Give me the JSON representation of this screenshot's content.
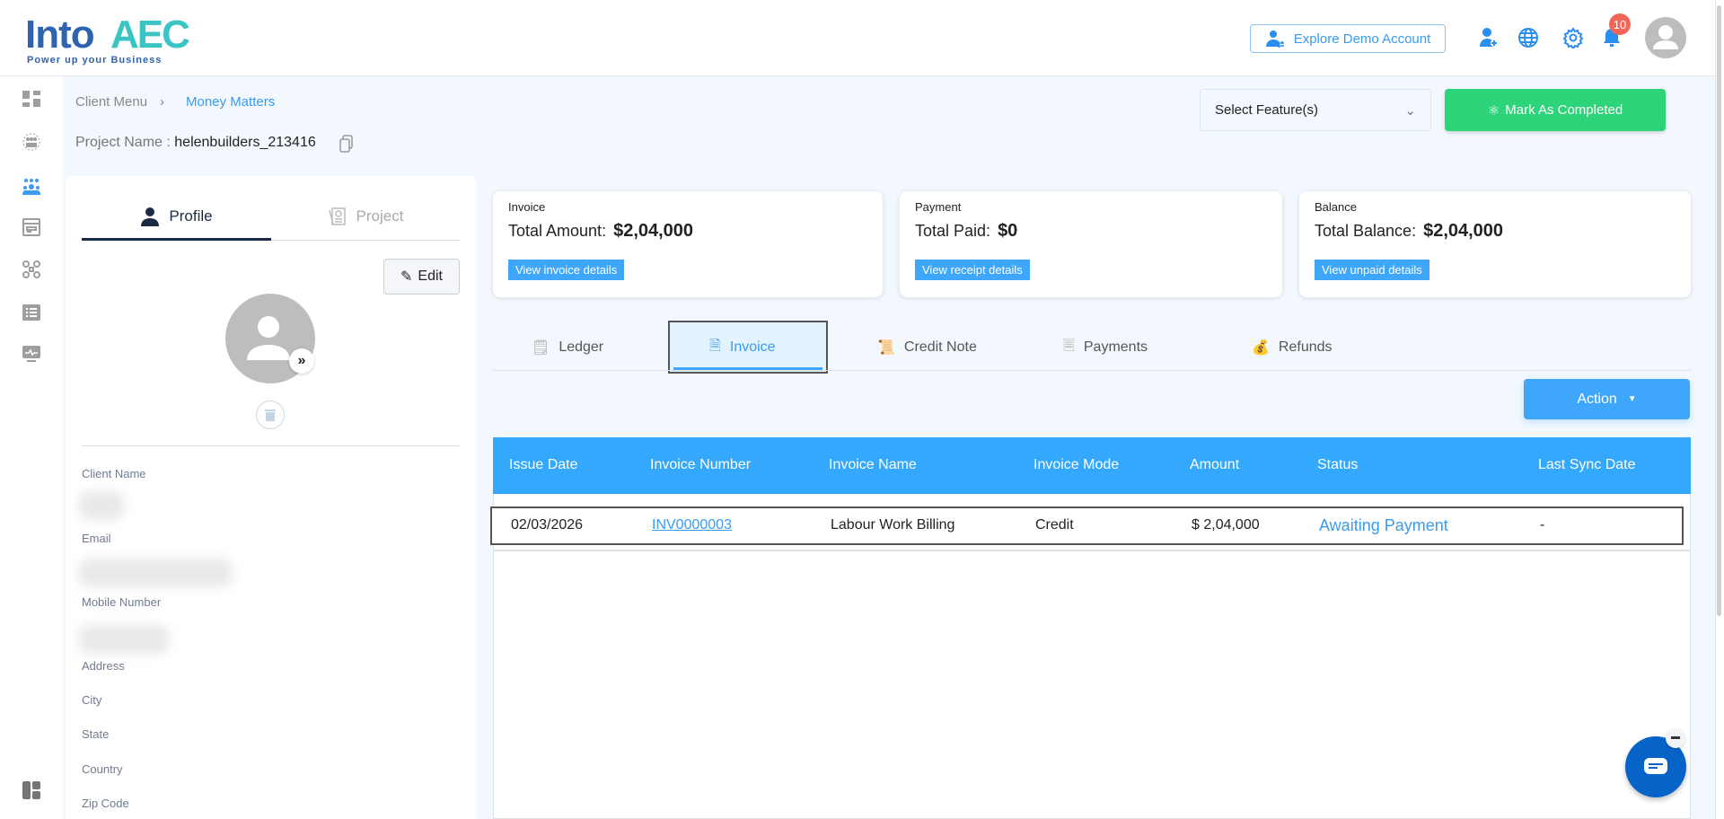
{
  "header": {
    "logo_text_main": "Into",
    "logo_text_accent": "AEC",
    "logo_tagline": "Power up your Business",
    "explore_label": "Explore Demo Account",
    "notification_count": "10"
  },
  "breadcrumb": {
    "root": "Client Menu",
    "current": "Money Matters"
  },
  "project": {
    "label": "Project Name :",
    "value": "helenbuilders_213416"
  },
  "toolbar": {
    "select_placeholder": "Select Feature(s)",
    "mark_completed": "Mark As Completed"
  },
  "profile": {
    "tabs": [
      "Profile",
      "Project"
    ],
    "edit_label": "Edit",
    "fields": [
      "Client Name",
      "Email",
      "Mobile Number",
      "Address",
      "City",
      "State",
      "Country",
      "Zip Code"
    ]
  },
  "cards": [
    {
      "title": "Invoice",
      "label": "Total Amount:",
      "value": "$2,04,000",
      "button": "View invoice details"
    },
    {
      "title": "Payment",
      "label": "Total Paid:",
      "value": "$0",
      "button": "View receipt details"
    },
    {
      "title": "Balance",
      "label": "Total Balance:",
      "value": "$2,04,000",
      "button": "View unpaid details"
    }
  ],
  "tabs": [
    "Ledger",
    "Invoice",
    "Credit Note",
    "Payments",
    "Refunds"
  ],
  "action_label": "Action",
  "table": {
    "columns": [
      "Issue Date",
      "Invoice Number",
      "Invoice Name",
      "Invoice Mode",
      "Amount",
      "Status",
      "Last Sync Date"
    ],
    "rows": [
      [
        "02/03/2026",
        "INV0000003",
        "Labour Work Billing",
        "Credit",
        "$ 2,04,000",
        "Awaiting Payment",
        "-"
      ]
    ]
  },
  "colors": {
    "primary": "#33a8fd",
    "success": "#2ed47a",
    "badge": "#f2665a",
    "chat": "#0863c9"
  }
}
